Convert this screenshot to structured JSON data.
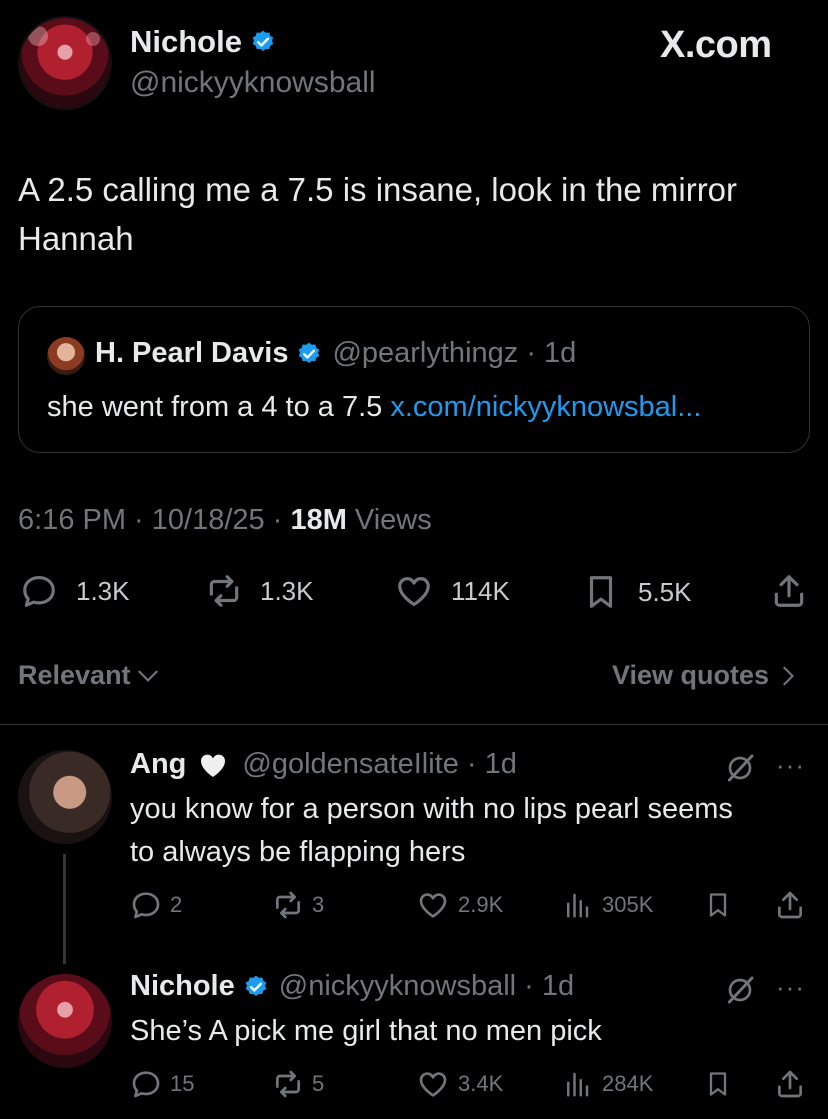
{
  "header": {
    "name": "Nichole",
    "handle": "@nickyyknowsball",
    "site": "X.com"
  },
  "tweet": {
    "text_line1": "A 2.5 calling me a 7.5 is insane, look in the mirror",
    "text_line2": "Hannah",
    "time": "6:16 PM · 10/18/25 · ",
    "views_count": "18M",
    "views_label": " Views",
    "stats": {
      "replies": "1.3K",
      "reposts": "1.3K",
      "likes": "114K",
      "bookmarks": "5.5K"
    }
  },
  "quote": {
    "name": "H. Pearl Davis",
    "meta": "@pearlythingz · 1d",
    "text": "she went from a 4 to a 7.5 ",
    "link": "x.com/nickyyknowsbal..."
  },
  "filters": {
    "sort_label": "Relevant",
    "quotes_label": "View quotes"
  },
  "replies": [
    {
      "name": "Ang",
      "meta": "@goldensateIlite · 1d",
      "line1": "you know for a person with no lips pearl seems",
      "line2": "to always be flapping hers",
      "replies": "2",
      "reposts": "3",
      "likes": "2.9K",
      "views": "305K"
    },
    {
      "name": "Nichole",
      "meta": "@nickyyknowsball · 1d",
      "line1": "She’s A pick me girl that no men pick",
      "replies": "15",
      "reposts": "5",
      "likes": "3.4K",
      "views": "284K"
    }
  ],
  "colors": {
    "background": "#000000",
    "text": "#e7e9ea",
    "muted": "#71767b",
    "link": "#1d9bf0",
    "verified": "#1d9bf0"
  }
}
